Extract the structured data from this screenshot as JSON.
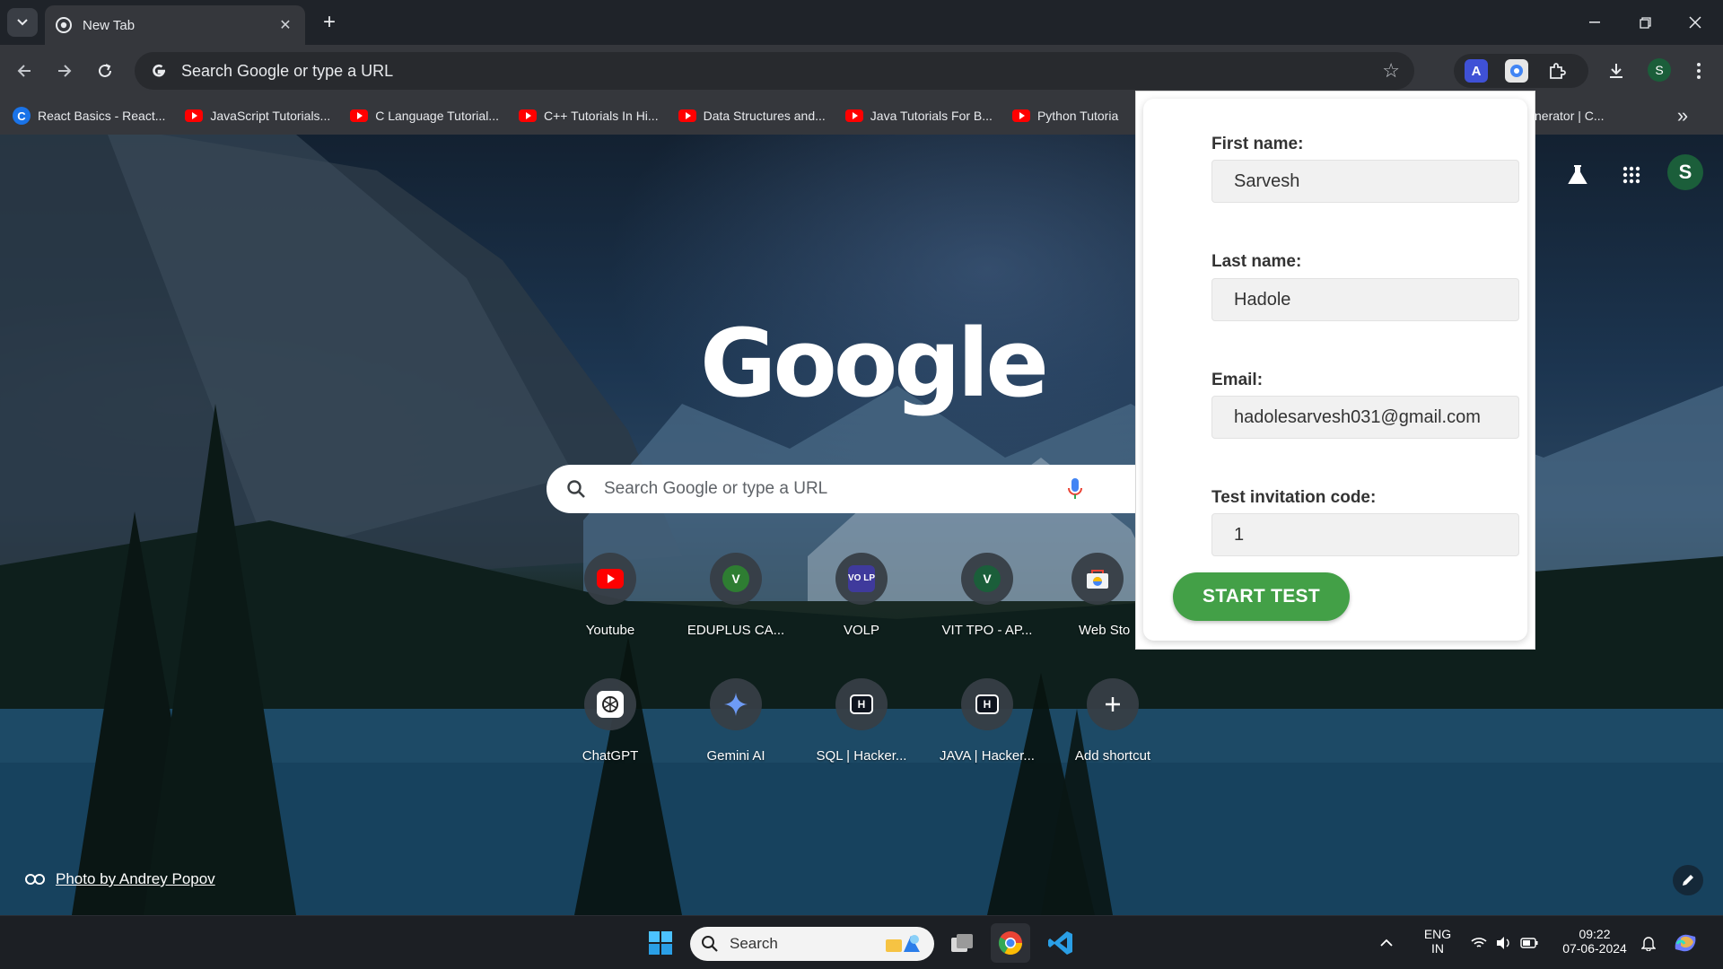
{
  "browser": {
    "tab_title": "New Tab",
    "omnibox_placeholder": "Search Google or type a URL",
    "profile_initial": "S"
  },
  "bookmarks": [
    {
      "label": "React Basics - React...",
      "icon": "c-icon"
    },
    {
      "label": "JavaScript Tutorials...",
      "icon": "youtube-icon"
    },
    {
      "label": "C Language Tutorial...",
      "icon": "youtube-icon"
    },
    {
      "label": "C++ Tutorials In Hi...",
      "icon": "youtube-icon"
    },
    {
      "label": "Data Structures and...",
      "icon": "youtube-icon"
    },
    {
      "label": "Java Tutorials For B...",
      "icon": "youtube-icon"
    },
    {
      "label": "Python Tutoria",
      "icon": "youtube-icon"
    }
  ],
  "bookmark_partial_right": "nerator | C...",
  "ntp": {
    "logo": "Google",
    "search_placeholder": "Search Google or type a URL",
    "profile_initial": "S",
    "photo_credit": "Photo by Andrey Popov",
    "shortcuts": [
      {
        "label": "Youtube",
        "icon": "youtube-icon"
      },
      {
        "label": "EDUPLUS CA...",
        "icon": "v-letter-icon",
        "letter": "V"
      },
      {
        "label": "VOLP",
        "icon": "volp-icon",
        "letter": "VO LP"
      },
      {
        "label": "VIT TPO - AP...",
        "icon": "v-letter-icon",
        "letter": "V"
      },
      {
        "label": "Web Sto",
        "icon": "web-store-icon"
      },
      {
        "label": "ChatGPT",
        "icon": "chatgpt-icon"
      },
      {
        "label": "Gemini AI",
        "icon": "gemini-icon"
      },
      {
        "label": "SQL | Hacker...",
        "icon": "hackerrank-icon",
        "letter": "H"
      },
      {
        "label": "JAVA | Hacker...",
        "icon": "hackerrank-icon",
        "letter": "H"
      },
      {
        "label": "Add shortcut",
        "icon": "plus-icon"
      }
    ]
  },
  "popup": {
    "first_name_label": "First name:",
    "first_name_value": "Sarvesh",
    "last_name_label": "Last name:",
    "last_name_value": "Hadole",
    "email_label": "Email:",
    "email_value": "hadolesarvesh031@gmail.com",
    "code_label": "Test invitation code:",
    "code_value": "1",
    "start_button": "START TEST"
  },
  "taskbar": {
    "search_label": "Search",
    "lang_top": "ENG",
    "lang_bottom": "IN",
    "time": "09:22",
    "date": "07-06-2024"
  },
  "colors": {
    "start_button": "#43a047",
    "chrome_dark": "#35373c",
    "taskbar": "#1c1f24"
  }
}
